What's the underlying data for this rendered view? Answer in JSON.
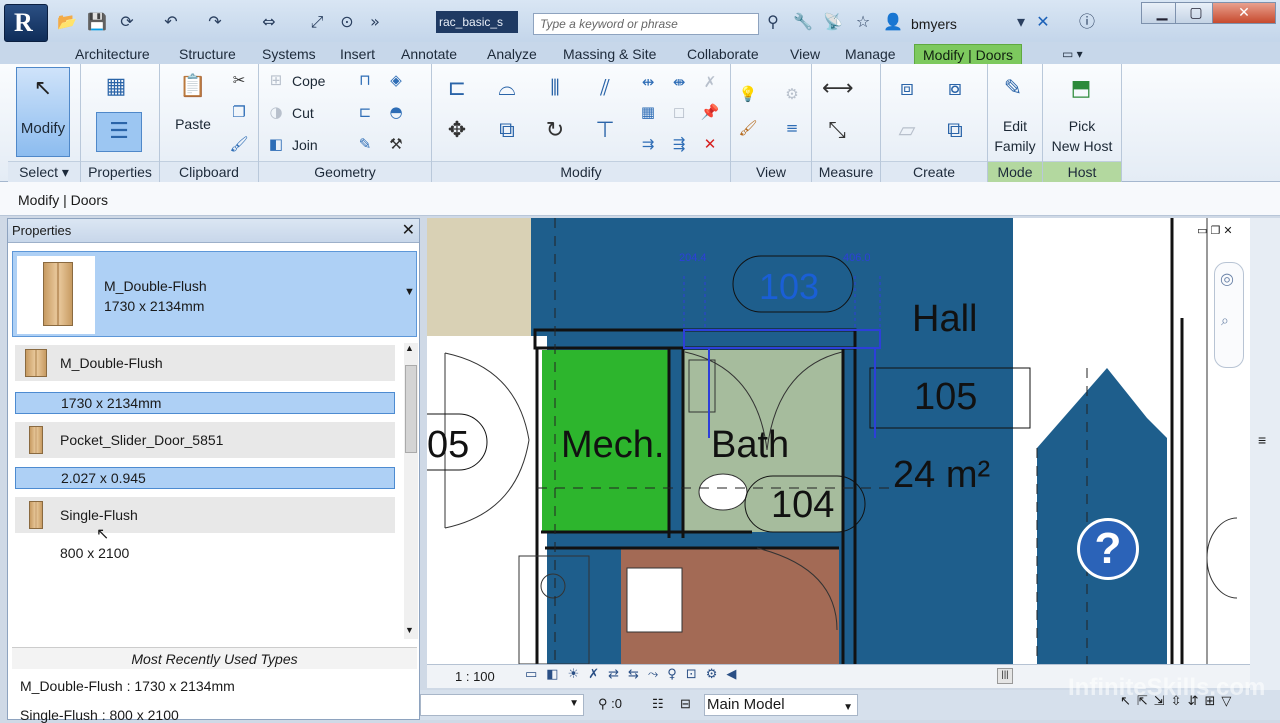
{
  "titlebar": {
    "doc_title": "rac_basic_s",
    "search_placeholder": "Type a keyword or phrase",
    "user": "bmyers"
  },
  "tabs": [
    "Architecture",
    "Structure",
    "Systems",
    "Insert",
    "Annotate",
    "Analyze",
    "Massing & Site",
    "Collaborate",
    "View",
    "Manage"
  ],
  "active_tab": "Modify | Doors",
  "ribbon": {
    "select": {
      "modify_label": "Modify",
      "panel": "Select"
    },
    "properties": {
      "panel": "Properties"
    },
    "clipboard": {
      "paste_label": "Paste",
      "panel": "Clipboard"
    },
    "geometry": {
      "cope": "Cope",
      "cut": "Cut",
      "join": "Join",
      "panel": "Geometry"
    },
    "modify": {
      "panel": "Modify"
    },
    "view": {
      "panel": "View"
    },
    "measure": {
      "panel": "Measure"
    },
    "create": {
      "panel": "Create"
    },
    "mode": {
      "edit_line1": "Edit",
      "edit_line2": "Family",
      "panel": "Mode"
    },
    "host": {
      "pick_line1": "Pick",
      "pick_line2": "New Host",
      "panel": "Host"
    }
  },
  "options_bar": "Modify | Doors",
  "properties": {
    "title": "Properties",
    "selected": {
      "family": "M_Double-Flush",
      "type": "1730 x 2134mm"
    },
    "list": [
      {
        "family": "M_Double-Flush",
        "type": "1730 x 2134mm",
        "type_selected": true
      },
      {
        "family": "Pocket_Slider_Door_5851",
        "type": "2.027 x 0.945",
        "type_selected": true
      },
      {
        "family": "Single-Flush",
        "type": "800 x 2100",
        "type_selected": false
      }
    ],
    "mru_title": "Most Recently Used Types",
    "mru": [
      "M_Double-Flush : 1730 x 2134mm",
      "Single-Flush : 800 x 2100"
    ]
  },
  "canvas": {
    "rooms": [
      {
        "name": "Hall",
        "number": "105",
        "area": "24 m²"
      },
      {
        "name": "Mech.",
        "number": ""
      },
      {
        "name": "Bath",
        "number": "104"
      }
    ],
    "tag_103": "103",
    "tag_05": "05",
    "dim_left": "204.4",
    "dim_right": "406.0",
    "help": "?"
  },
  "viewbar": {
    "scale": "1 : 100"
  },
  "statusbar": {
    "selection_count": ":0",
    "model": "Main Model"
  },
  "watermark": "InfiniteSkills.com",
  "colors": {
    "ribbon_active": "#7dc95e",
    "hall": "#1e5e8c",
    "mech": "#2db52d",
    "bath": "#a6bc9d",
    "brown": "#a36a55",
    "tan": "#d9d1b5"
  }
}
